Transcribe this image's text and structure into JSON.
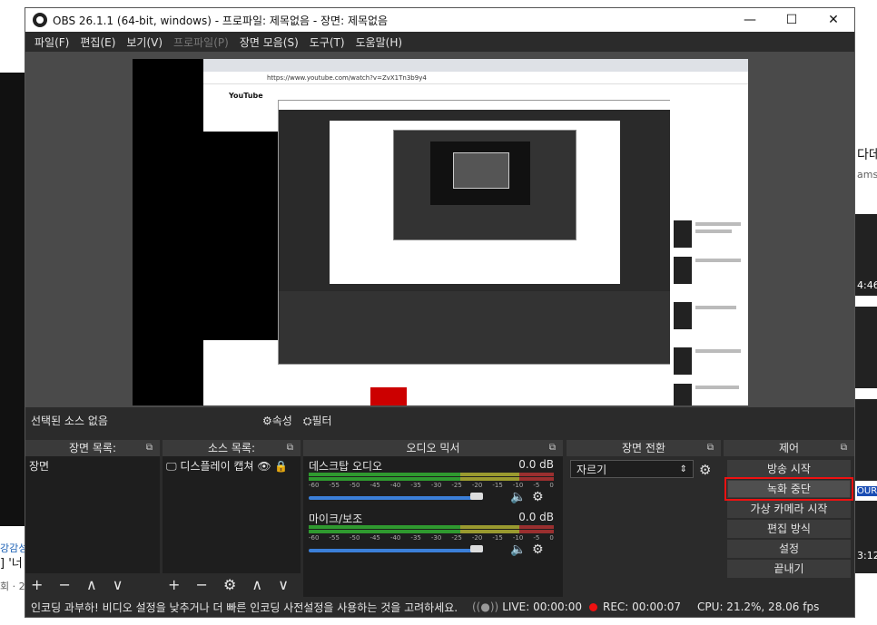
{
  "window": {
    "title": "OBS 26.1.1 (64-bit, windows) - 프로파일: 제목없음 - 장면: 제목없음",
    "minimize": "—",
    "maximize": "☐",
    "close": "✕"
  },
  "menu": [
    "파일(F)",
    "편집(E)",
    "보기(V)",
    "프로파일(P)",
    "장면 모음(S)",
    "도구(T)",
    "도움말(H)"
  ],
  "background": {
    "right_text_1": "다데",
    "right_text_2": "amsu",
    "right_text_3": "4:46",
    "right_text_4": "OUR",
    "right_text_5": "3:12",
    "left_text_1": "강감성",
    "left_text_2": "] '너",
    "left_text_3": "회 · 2"
  },
  "preview_capture": {
    "url": "https://www.youtube.com/watch?v=ZvX1Tn3b9y4",
    "brand": "YouTube"
  },
  "source_bar": {
    "label": "선택된 소스 없음",
    "properties": "속성",
    "filters": "필터"
  },
  "docks": {
    "scenes": {
      "title": "장면 목록:",
      "items": [
        "장면"
      ],
      "footer": "+ − ∧ ∨"
    },
    "sources": {
      "title": "소스 목록:",
      "items": [
        {
          "name": "디스플레이 캡쳐"
        }
      ],
      "footer": "+ − ⚙ ∧ ∨"
    },
    "mixer": {
      "title": "오디오 믹서",
      "channels": [
        {
          "name": "데스크탑 오디오",
          "db": "0.0 dB",
          "volume": 0.96
        },
        {
          "name": "마이크/보조",
          "db": "0.0 dB",
          "volume": 0.96
        }
      ],
      "ticks": [
        "-60",
        "-55",
        "-50",
        "-45",
        "-40",
        "-35",
        "-30",
        "-25",
        "-20",
        "-15",
        "-10",
        "-5",
        "0"
      ]
    },
    "transitions": {
      "title": "장면 전환",
      "selected": "자르기"
    },
    "controls": {
      "title": "제어",
      "buttons": [
        "방송 시작",
        "녹화 중단",
        "가상 카메라 시작",
        "편집 방식",
        "설정",
        "끝내기"
      ]
    }
  },
  "status": {
    "message": "인코딩 과부하! 비디오 설정을 낮추거나 더 빠른 인코딩 사전설정을 사용하는 것을 고려하세요.",
    "live": "LIVE: 00:00:00",
    "rec": "REC: 00:00:07",
    "cpu": "CPU: 21.2%, 28.06 fps"
  },
  "colors": {
    "accent_red": "#e11111",
    "meter_green": "#2f9a2f",
    "slider_blue": "#3b7fd9"
  }
}
